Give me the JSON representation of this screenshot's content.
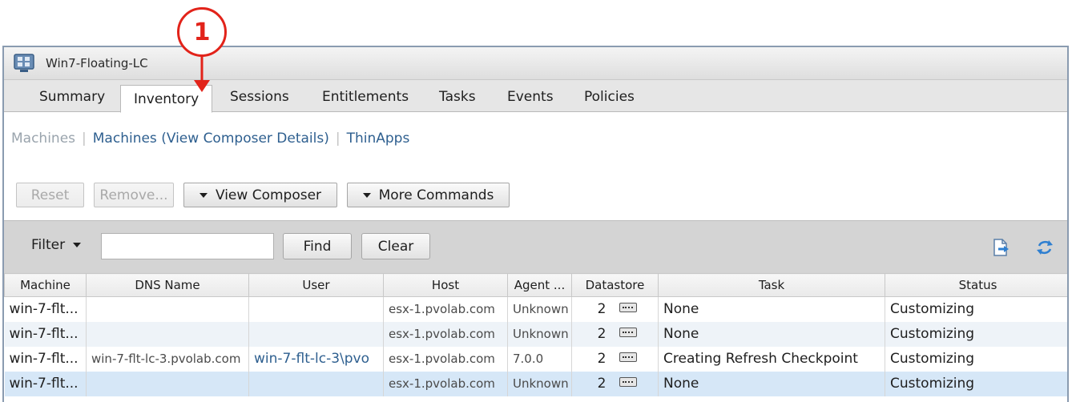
{
  "annotation": {
    "marker": "1"
  },
  "window": {
    "title": "Win7-Floating-LC",
    "icon": "desktop-pool-icon"
  },
  "tabs": [
    {
      "label": "Summary",
      "active": false
    },
    {
      "label": "Inventory",
      "active": true
    },
    {
      "label": "Sessions",
      "active": false
    },
    {
      "label": "Entitlements",
      "active": false
    },
    {
      "label": "Tasks",
      "active": false
    },
    {
      "label": "Events",
      "active": false
    },
    {
      "label": "Policies",
      "active": false
    }
  ],
  "subnav": {
    "machines": "Machines",
    "separator": "|",
    "composer_details": "Machines (View Composer Details)",
    "thinapps": "ThinApps"
  },
  "actions": {
    "reset": "Reset",
    "remove": "Remove...",
    "view_composer": "View Composer",
    "more_commands": "More Commands"
  },
  "filter": {
    "label": "Filter",
    "input_value": "",
    "find": "Find",
    "clear": "Clear",
    "export_icon": "export-icon",
    "refresh_icon": "refresh-icon"
  },
  "table": {
    "columns": [
      "Machine",
      "DNS Name",
      "User",
      "Host",
      "Agent ...",
      "Datastore",
      "Task",
      "Status"
    ],
    "rows": [
      {
        "machine": "win-7-flt...",
        "dns": "",
        "user": "",
        "host": "esx-1.pvolab.com",
        "agent": "Unknown",
        "datastore": "2",
        "task": "None",
        "status": "Customizing"
      },
      {
        "machine": "win-7-flt...",
        "dns": "",
        "user": "",
        "host": "esx-1.pvolab.com",
        "agent": "Unknown",
        "datastore": "2",
        "task": "None",
        "status": "Customizing"
      },
      {
        "machine": "win-7-flt...",
        "dns": "win-7-flt-lc-3.pvolab.com",
        "user": "win-7-flt-lc-3\\pvo",
        "host": "esx-1.pvolab.com",
        "agent": "7.0.0",
        "datastore": "2",
        "task": "Creating Refresh Checkpoint",
        "status": "Customizing"
      },
      {
        "machine": "win-7-flt...",
        "dns": "",
        "user": "",
        "host": "esx-1.pvolab.com",
        "agent": "Unknown",
        "datastore": "2",
        "task": "None",
        "status": "Customizing"
      }
    ]
  },
  "colors": {
    "accent_red": "#e2231a",
    "link_blue": "#2e5f8f",
    "selected_row": "#d6e7f7"
  }
}
